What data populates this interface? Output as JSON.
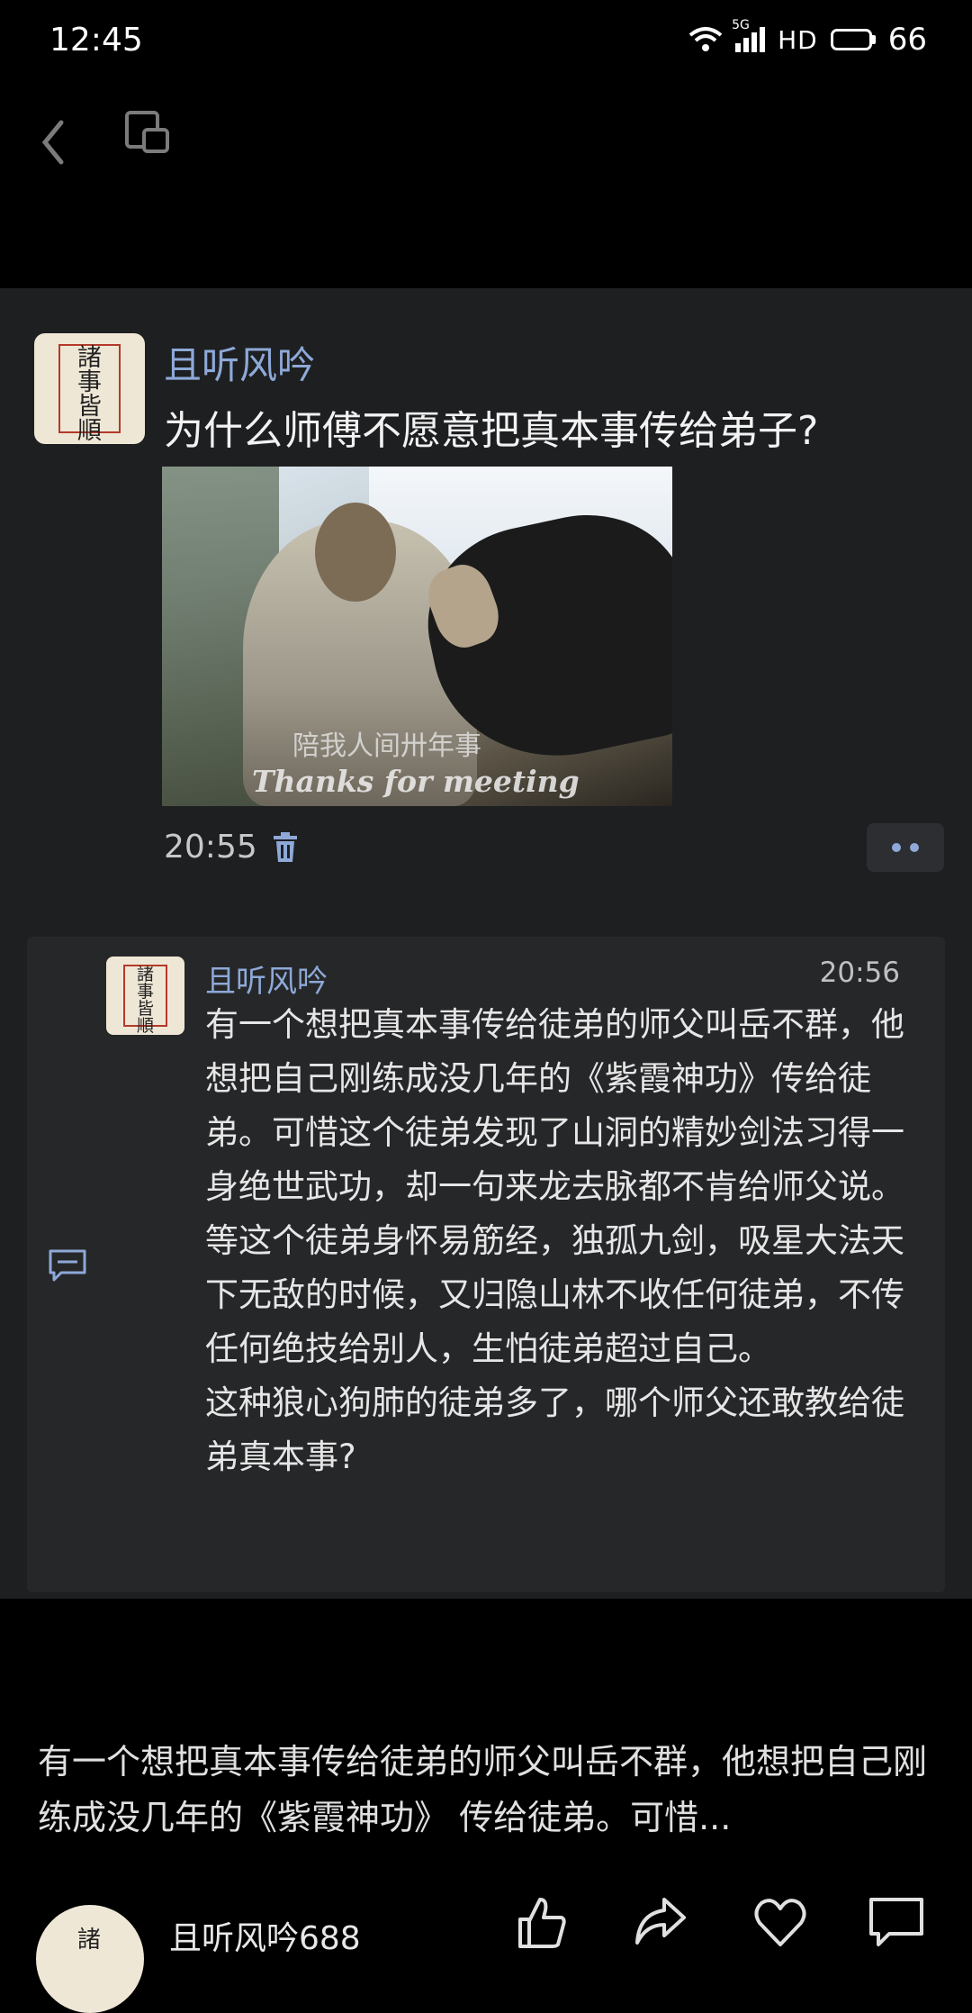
{
  "status_bar": {
    "time": "12:45",
    "network": "5G",
    "hd": "HD",
    "battery": "66"
  },
  "post": {
    "author": "且听风吟",
    "title": "为什么师傅不愿意把真本事传给弟子?",
    "avatar_text": [
      "諸",
      "事",
      "皆",
      "順"
    ],
    "video": {
      "subtitle_cn": "陪我人间卅年事",
      "subtitle_en": "Thanks for meeting"
    },
    "time": "20:55"
  },
  "reply": {
    "author": "且听风吟",
    "time": "20:56",
    "paragraphs": [
      "有一个想把真本事传给徒弟的师父叫岳不群，他想把自己刚练成没几年的《紫霞神功》传给徒弟。可惜这个徒弟发现了山洞的精妙剑法习得一身绝世武功，却一句来龙去脉都不肯给师父说。",
      "等这个徒弟身怀易筋经，独孤九剑，吸星大法天下无敌的时候，又归隐山林不收任何徒弟，不传任何绝技给别人，生怕徒弟超过自己。",
      "这种狼心狗肺的徒弟多了，哪个师父还敢教给徒弟真本事?"
    ]
  },
  "preview": {
    "text": "有一个想把真本事传给徒弟的师父叫岳不群，他想把自己刚练成没几年的《紫霞神功》 传给徒弟。可惜..."
  },
  "bottom": {
    "username": "且听风吟688",
    "avatar_text": "諸"
  },
  "colors": {
    "accent": "#8ea9d8",
    "panel": "#1e1f21",
    "card": "#262729"
  }
}
